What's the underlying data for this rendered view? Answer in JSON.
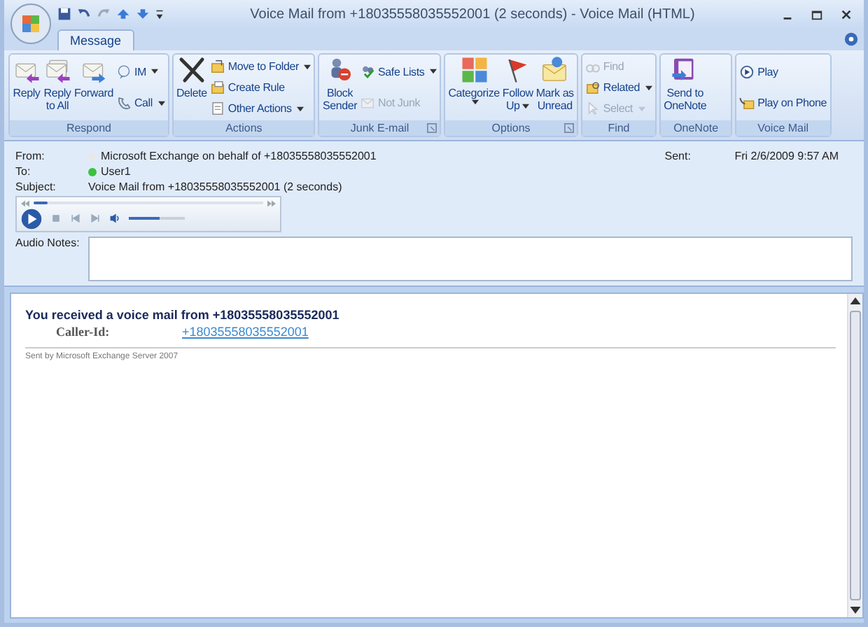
{
  "window": {
    "title": "Voice Mail from +18035558035552001 (2 seconds) - Voice Mail (HTML)"
  },
  "tabs": [
    {
      "label": "Message",
      "selected": true
    }
  ],
  "ribbon": [
    {
      "label": "Respond",
      "launcher": false,
      "buttons": [
        {
          "kind": "large",
          "lines": [
            "Reply"
          ],
          "disabled": false,
          "dropdown": false
        },
        {
          "kind": "large",
          "lines": [
            "Reply",
            "to All"
          ],
          "disabled": false,
          "dropdown": false
        },
        {
          "kind": "large",
          "lines": [
            "Forward"
          ],
          "disabled": false,
          "dropdown": false
        },
        {
          "kind": "small",
          "lines": [
            "IM"
          ],
          "disabled": false,
          "dropdown": true
        },
        {
          "kind": "small",
          "lines": [
            "Call"
          ],
          "disabled": false,
          "dropdown": true
        }
      ]
    },
    {
      "label": "Actions",
      "launcher": false,
      "buttons": [
        {
          "kind": "large",
          "lines": [
            "Delete"
          ],
          "disabled": false,
          "dropdown": false
        },
        {
          "kind": "small",
          "lines": [
            "Move to Folder"
          ],
          "disabled": false,
          "dropdown": true
        },
        {
          "kind": "small",
          "lines": [
            "Create Rule"
          ],
          "disabled": false,
          "dropdown": false
        },
        {
          "kind": "small",
          "lines": [
            "Other Actions"
          ],
          "disabled": false,
          "dropdown": true
        }
      ]
    },
    {
      "label": "Junk E-mail",
      "launcher": true,
      "buttons": [
        {
          "kind": "large",
          "lines": [
            "Block",
            "Sender"
          ],
          "disabled": false,
          "dropdown": false
        },
        {
          "kind": "small",
          "lines": [
            "Safe Lists"
          ],
          "disabled": false,
          "dropdown": true
        },
        {
          "kind": "small",
          "lines": [
            "Not Junk"
          ],
          "disabled": true,
          "dropdown": false
        }
      ]
    },
    {
      "label": "Options",
      "launcher": true,
      "buttons": [
        {
          "kind": "large",
          "lines": [
            "Categorize"
          ],
          "disabled": false,
          "dropdown": true
        },
        {
          "kind": "large",
          "lines": [
            "Follow",
            "Up"
          ],
          "disabled": false,
          "dropdown": true
        },
        {
          "kind": "large",
          "lines": [
            "Mark as",
            "Unread"
          ],
          "disabled": false,
          "dropdown": false
        }
      ]
    },
    {
      "label": "Find",
      "launcher": false,
      "buttons": [
        {
          "kind": "small",
          "lines": [
            "Find"
          ],
          "disabled": true,
          "dropdown": false
        },
        {
          "kind": "small",
          "lines": [
            "Related"
          ],
          "disabled": false,
          "dropdown": true
        },
        {
          "kind": "small",
          "lines": [
            "Select"
          ],
          "disabled": true,
          "dropdown": true
        }
      ]
    },
    {
      "label": "OneNote",
      "launcher": false,
      "buttons": [
        {
          "kind": "large",
          "lines": [
            "Send to",
            "OneNote"
          ],
          "disabled": false,
          "dropdown": false
        }
      ]
    },
    {
      "label": "Voice Mail",
      "launcher": false,
      "buttons": [
        {
          "kind": "small",
          "lines": [
            "Play"
          ],
          "disabled": false,
          "dropdown": false
        },
        {
          "kind": "small",
          "lines": [
            "Play on Phone"
          ],
          "disabled": false,
          "dropdown": false
        }
      ]
    }
  ],
  "header": {
    "from": {
      "label": "From:",
      "value": "Microsoft Exchange on behalf of +18035558035552001",
      "color": "#e8e8e8"
    },
    "to": {
      "label": "To:",
      "value": "User1",
      "color": "#3cc23c"
    },
    "subject": {
      "label": "Subject:",
      "value": "Voice Mail from +18035558035552001 (2 seconds)"
    },
    "sent": {
      "label": "Sent:",
      "value": "Fri 2/6/2009 9:57 AM"
    }
  },
  "player": {
    "position": {
      "level": 0.06
    },
    "volume": {
      "level": 0.55
    }
  },
  "audio_notes": {
    "label": "Audio Notes:"
  },
  "body": {
    "heading": "You received a voice mail from +18035558035552001",
    "caller_label": "Caller-Id:",
    "caller_link": "+18035558035552001",
    "footer": "Sent by Microsoft Exchange Server 2007"
  }
}
